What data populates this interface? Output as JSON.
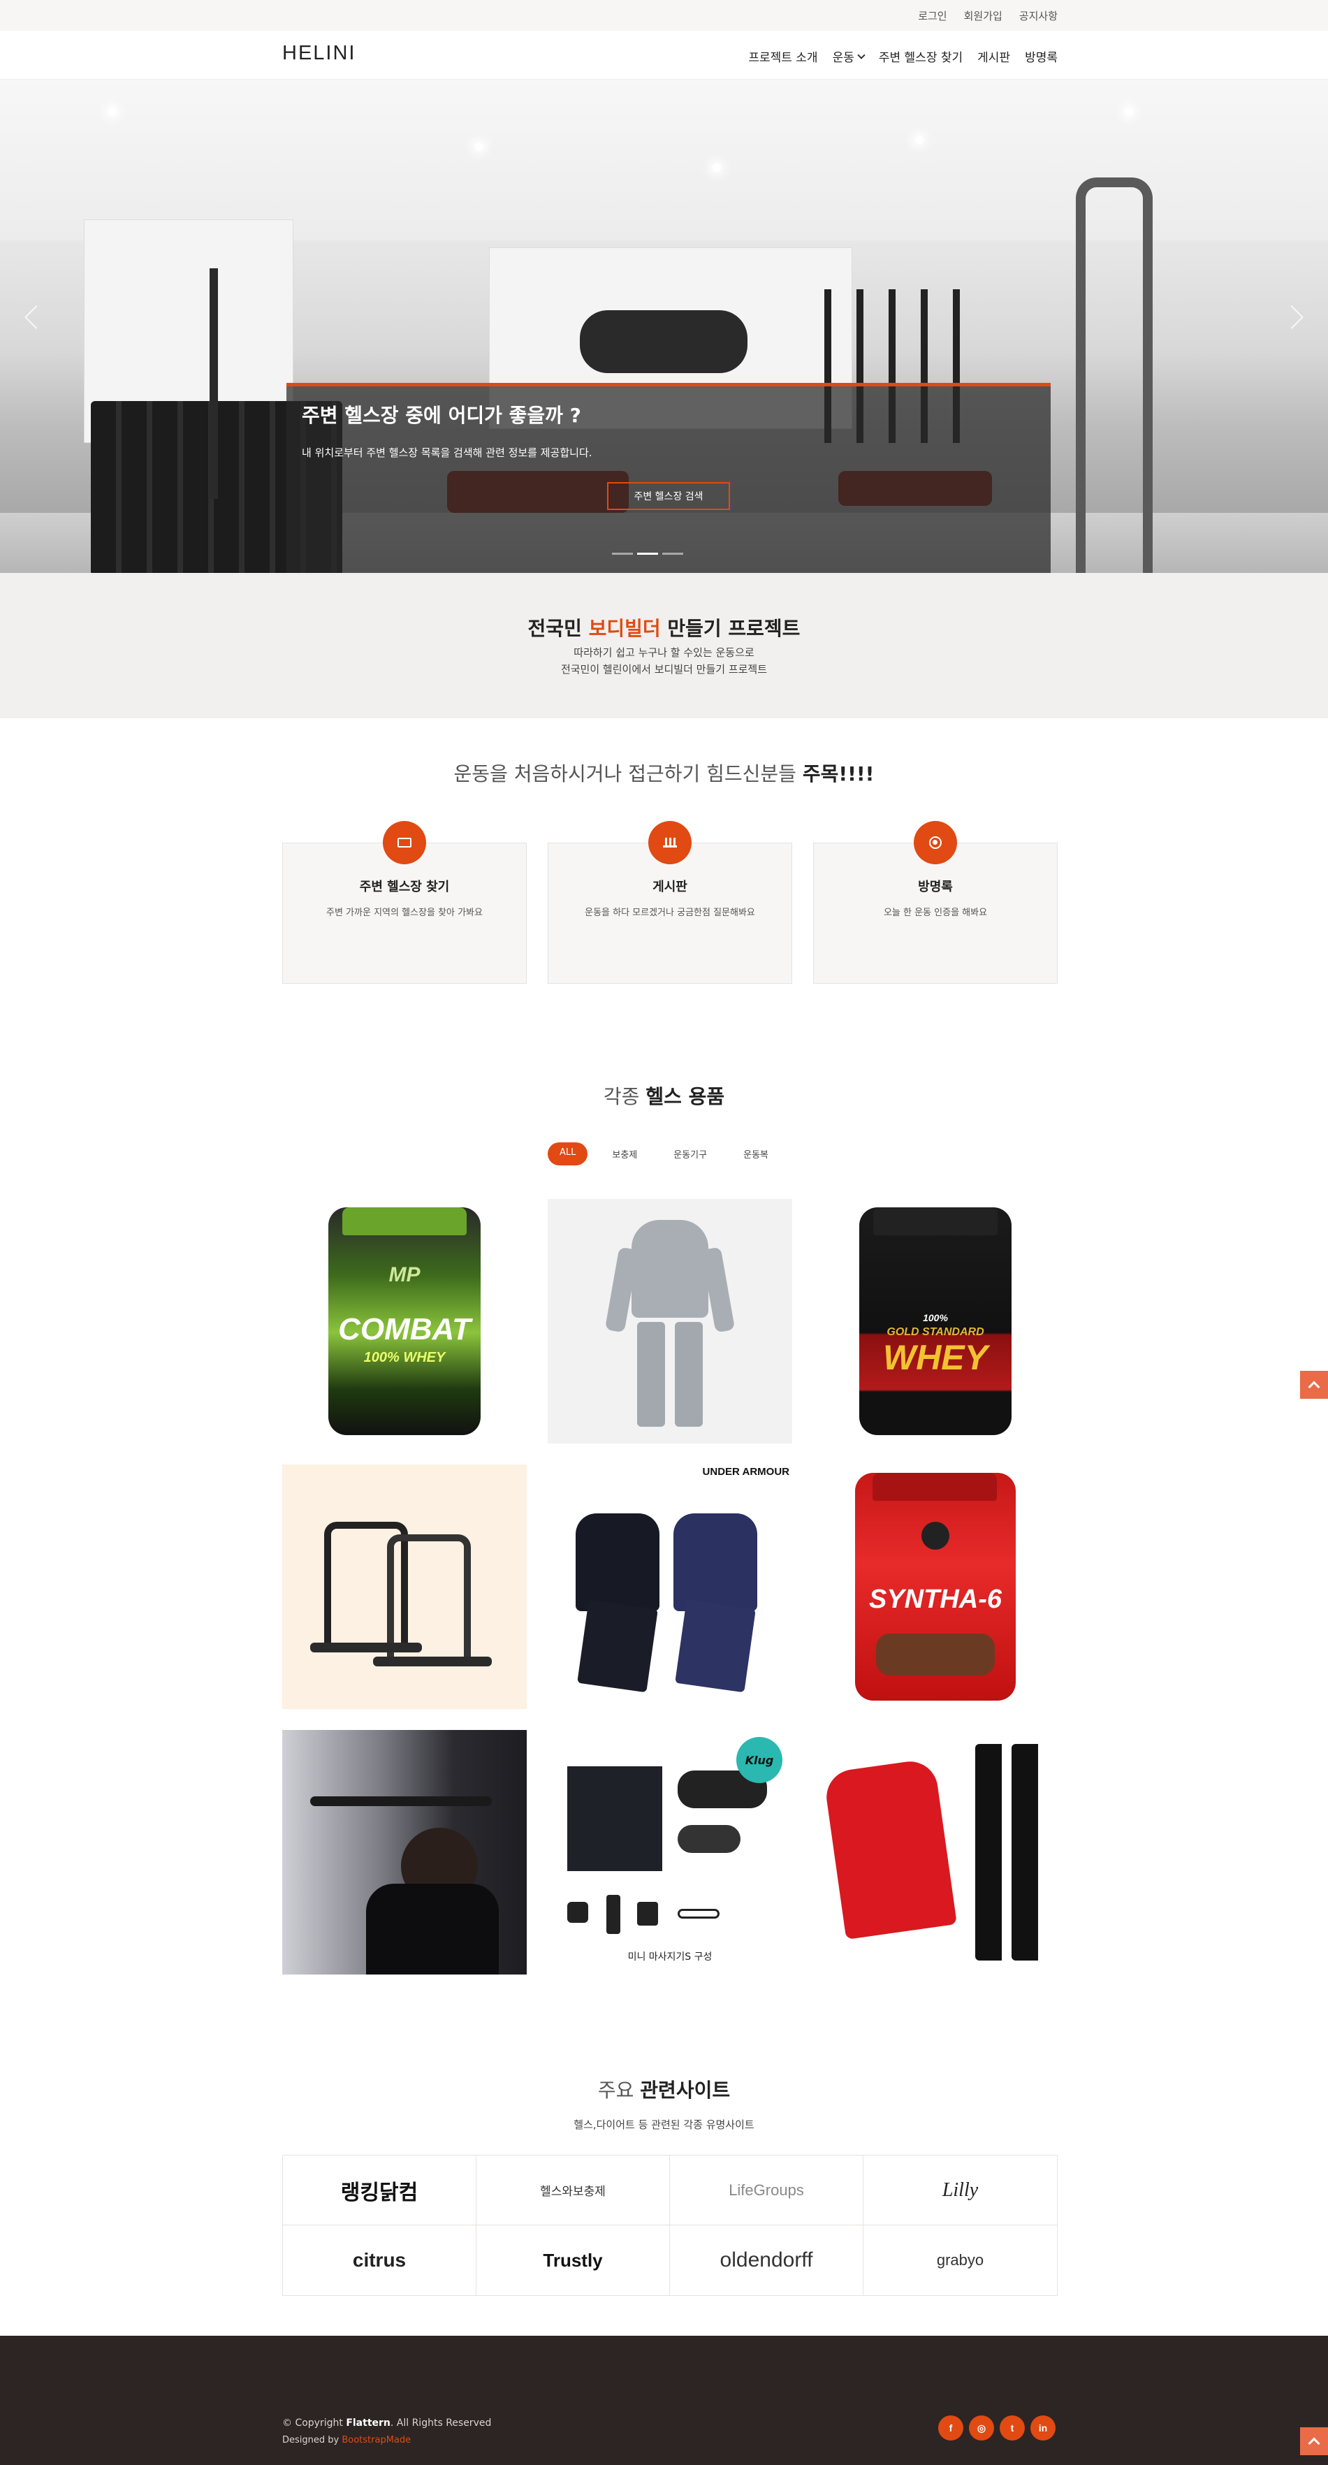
{
  "topbar": {
    "links": [
      "로그인",
      "회원가입",
      "공지사항"
    ]
  },
  "header": {
    "logo": "HELINI",
    "nav": [
      "프로젝트 소개",
      "운동",
      "주변 헬스장 찾기",
      "게시판",
      "방명록"
    ]
  },
  "hero": {
    "title": "주변 헬스장 중에 어디가 좋을까 ?",
    "text": "내 위치로부터 주변 헬스장 목록을 검색해 관련 정보를 제공합니다.",
    "button": "주변 헬스장 검색",
    "slide_count": 3,
    "active_slide": 2
  },
  "intro": {
    "title_pre": "전국민 ",
    "title_highlight": "보디빌더",
    "title_post": " 만들기 프로젝트",
    "line1": "따라하기 쉽고 누구나 할 수있는 운동으로",
    "line2": "전국민이 헬린이에서 보디빌더 만들기 프로젝트"
  },
  "services": {
    "title_pre": "운동을 처음하시거나 접근하기 힘드신분들 ",
    "title_bold": "주목!!!!",
    "items": [
      {
        "title": "주변 헬스장 찾기",
        "desc": "주변 가까운 지역의 헬스장을 찾아 가봐요",
        "icon": "monitor-icon"
      },
      {
        "title": "게시판",
        "desc": "운동을 하다 모르겠거나 궁금한점 질문해봐요",
        "icon": "bar-chart-icon"
      },
      {
        "title": "방명록",
        "desc": "오늘 한 운동 인증을 해봐요",
        "icon": "globe-icon"
      }
    ]
  },
  "products": {
    "title_pre": "각종 ",
    "title_bold": "헬스 용품",
    "filters": [
      "ALL",
      "보충제",
      "운동기구",
      "운동복"
    ],
    "active_filter": "ALL",
    "items": {
      "combat": {
        "brand": "MP",
        "name": "COMBAT",
        "sub": "100% WHEY"
      },
      "whey": {
        "brand": "GOLD STANDARD",
        "name": "WHEY",
        "pct": "100%"
      },
      "ua": {
        "brand": "UNDER ARMOUR"
      },
      "syntha": {
        "name": "SYNTHA-6"
      },
      "massager": {
        "badge": "Klug",
        "caption": "미니 마사지기S 구성"
      }
    }
  },
  "related": {
    "title_pre": "주요 ",
    "title_bold": "관련사이트",
    "subtitle": "헬스,다이어트 등 관련된 각종 유명사이트",
    "clients": [
      "랭킹닭컴",
      "헬스와보충제",
      "LifeGroups",
      "Lilly",
      "citrus",
      "Trustly",
      "oldendorff",
      "grabyo"
    ]
  },
  "footer": {
    "copy_pre": "© Copyright ",
    "copy_brand": "Flattern",
    "copy_post": ". All Rights Reserved",
    "credit_pre": "Designed by ",
    "credit_link": "BootstrapMade",
    "social": [
      "f",
      "◎",
      "t",
      "in"
    ]
  },
  "colors": {
    "accent": "#e14a12",
    "footer": "#2c2524",
    "band": "#f2f0ee"
  }
}
